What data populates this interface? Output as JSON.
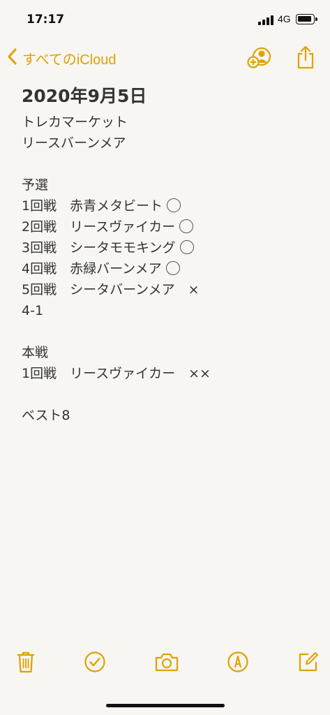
{
  "status_bar": {
    "time": "17:17",
    "network": "4G",
    "battery_level": 0.85,
    "signal_bars": 4
  },
  "nav": {
    "back_label": "すべてのiCloud",
    "accent": "#e0a100"
  },
  "note": {
    "title": "2020年9月5日",
    "lines": [
      "トレカマーケット",
      "リースバーンメア",
      "",
      "予選",
      "1回戦　赤青メタビート",
      "2回戦　リースヴァイカー",
      "3回戦　シータモモキング",
      "4回戦　赤緑バーンメア",
      "5回戦　シータバーンメア　×",
      "4-1",
      "",
      "本戦",
      "1回戦　リースヴァイカー　××",
      "",
      "ベスト8"
    ],
    "circle_marks": [
      "4",
      "5",
      "6",
      "7"
    ]
  },
  "toolbar": {
    "icons": [
      "trash-icon",
      "checklist-icon",
      "camera-icon",
      "markup-icon",
      "compose-icon"
    ]
  }
}
